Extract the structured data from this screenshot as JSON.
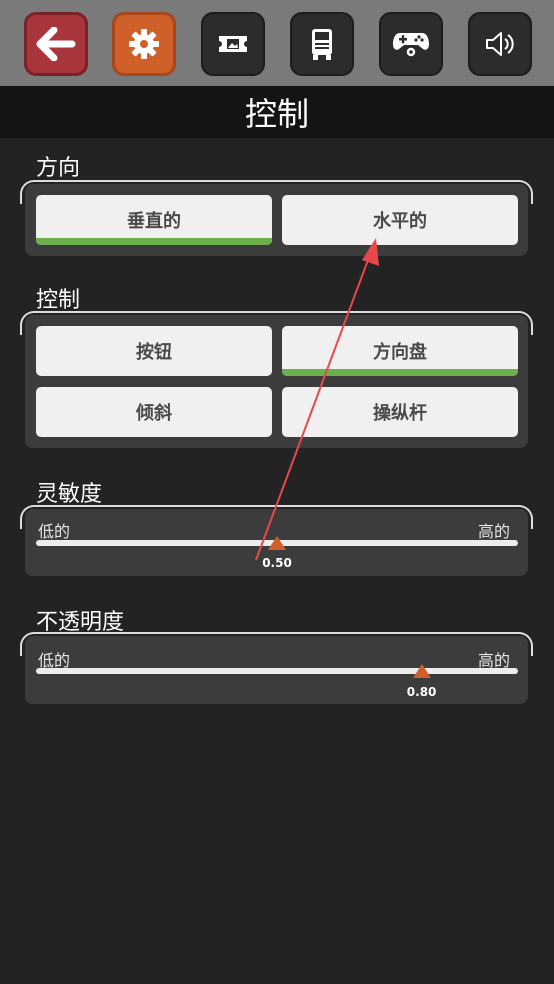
{
  "toolbar": {
    "buttons": [
      {
        "icon": "back-arrow-icon",
        "color": "#a8343c"
      },
      {
        "icon": "gear-icon",
        "color": "#d0602a"
      },
      {
        "icon": "ticket-image-icon",
        "color": "#2c2c2c"
      },
      {
        "icon": "truck-icon",
        "color": "#2c2c2c"
      },
      {
        "icon": "gamepad-gear-icon",
        "color": "#2c2c2c"
      },
      {
        "icon": "speaker-icon",
        "color": "#2c2c2c"
      }
    ]
  },
  "header": {
    "title": "控制"
  },
  "direction": {
    "label": "方向",
    "options": [
      {
        "label": "垂直的",
        "selected": true
      },
      {
        "label": "水平的",
        "selected": false
      }
    ]
  },
  "control": {
    "label": "控制",
    "options": [
      {
        "label": "按钮",
        "selected": false
      },
      {
        "label": "方向盘",
        "selected": true
      },
      {
        "label": "倾斜",
        "selected": false
      },
      {
        "label": "操纵杆",
        "selected": false
      }
    ]
  },
  "sensitivity": {
    "label": "灵敏度",
    "low": "低的",
    "high": "高的",
    "value": "0.50",
    "fraction": 0.5
  },
  "opacity": {
    "label": "不透明度",
    "low": "低的",
    "high": "高的",
    "value": "0.80",
    "fraction": 0.8
  },
  "colors": {
    "accent_green": "#6bb04c",
    "accent_orange": "#d0602a",
    "annotation_arrow": "#e8484a"
  }
}
